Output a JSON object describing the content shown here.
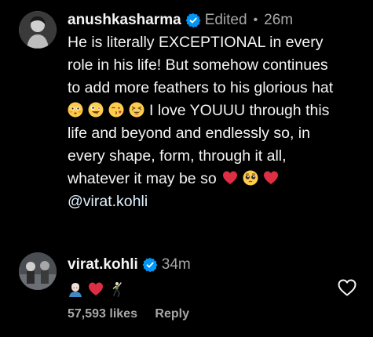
{
  "comment1": {
    "username": "anushkasharma",
    "edited_label": "Edited",
    "separator": "•",
    "time": "26m",
    "text_line1": "He is literally EXCEPTIONAL in every",
    "text_line2": "role in his life! But somehow continues",
    "text_line3": "to add more feathers to his glorious hat",
    "text_line4": "I love YOUUU through this",
    "text_line5": "life and beyond and endlessly so, in",
    "text_line6": "every shape, form, through it all,",
    "text_line7": "whatever it may be so",
    "mention": "@virat.kohli",
    "emojis_line4": [
      "flushed-face",
      "zany-face",
      "face-blowing-kiss",
      "grinning-squinting-face"
    ],
    "emojis_line7": [
      "red-heart",
      "pleading-face",
      "red-heart"
    ]
  },
  "comment2": {
    "username": "virat.kohli",
    "time": "34m",
    "emojis": [
      "man-white-hair",
      "red-heart",
      "man-dancing"
    ],
    "likes": "57,593 likes",
    "reply_label": "Reply"
  },
  "colors": {
    "background": "#000000",
    "text": "#f5f5f5",
    "secondary": "#a8a8a8",
    "verified": "#0095f6",
    "mention": "#e0f1ff"
  }
}
